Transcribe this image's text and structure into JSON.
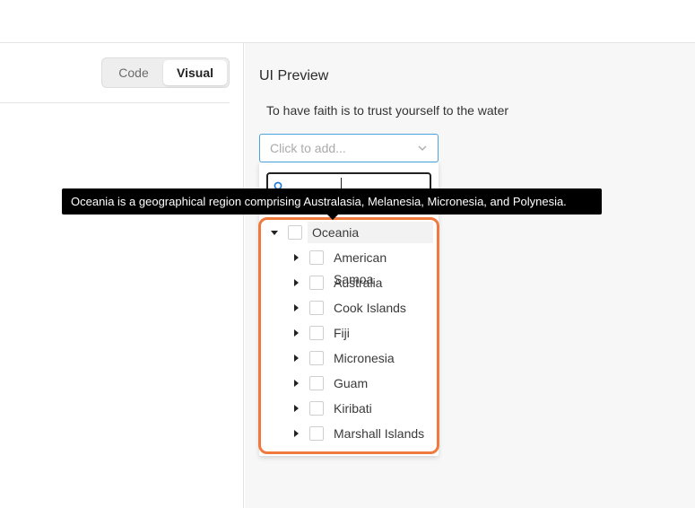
{
  "view_toggle": {
    "code_label": "Code",
    "visual_label": "Visual",
    "selected": "Visual"
  },
  "preview": {
    "title": "UI Preview",
    "quote": "To have faith is to trust yourself to the water"
  },
  "select": {
    "placeholder": "Click to add...",
    "icon": "chevron-down-icon"
  },
  "dropdown": {
    "search_value": "",
    "tree": {
      "root": {
        "label": "Oceania",
        "expanded": true,
        "checked": false
      },
      "children": [
        {
          "label": "American Samoa",
          "expanded": false,
          "checked": false
        },
        {
          "label": "Australia",
          "expanded": false,
          "checked": false
        },
        {
          "label": "Cook Islands",
          "expanded": false,
          "checked": false
        },
        {
          "label": "Fiji",
          "expanded": false,
          "checked": false
        },
        {
          "label": "Micronesia",
          "expanded": false,
          "checked": false
        },
        {
          "label": "Guam",
          "expanded": false,
          "checked": false
        },
        {
          "label": "Kiribati",
          "expanded": false,
          "checked": false
        },
        {
          "label": "Marshall Islands",
          "expanded": false,
          "checked": false
        }
      ]
    }
  },
  "tooltip": {
    "text": "Oceania is a geographical region comprising Australasia, Melanesia, Micronesia, and Polynesia."
  },
  "colors": {
    "accent": "#4aa3df",
    "highlight": "#f07a3e",
    "tooltip_bg": "#000000"
  }
}
